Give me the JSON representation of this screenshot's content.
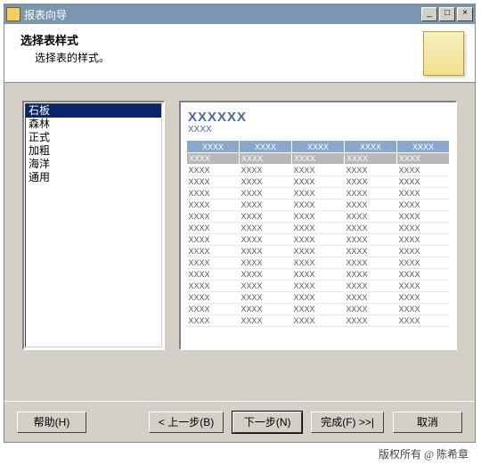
{
  "titlebar": {
    "title": "报表向导"
  },
  "header": {
    "heading": "选择表样式",
    "sub": "选择表的样式。"
  },
  "styles": {
    "items": [
      "石板",
      "森林",
      "正式",
      "加粗",
      "海洋",
      "通用"
    ],
    "selected": 0
  },
  "preview": {
    "title": "XXXXXX",
    "sub": "XXXX",
    "header_row": [
      "XXXX",
      "XXXX",
      "XXXX",
      "XXXX",
      "XXXX"
    ],
    "sub_row": [
      "XXXX",
      "XXXX",
      "XXXX",
      "XXXX",
      "XXXX"
    ],
    "data_cell": "XXXX",
    "rows": 14,
    "cols": 5
  },
  "buttons": {
    "help": "帮助(H)",
    "back": "< 上一步(B)",
    "next": "下一步(N)",
    "finish": "完成(F) >>|",
    "cancel": "取消"
  },
  "winbtns": {
    "min": "_",
    "max": "□",
    "close": "×"
  },
  "copyright": "版权所有 @ 陈希章"
}
